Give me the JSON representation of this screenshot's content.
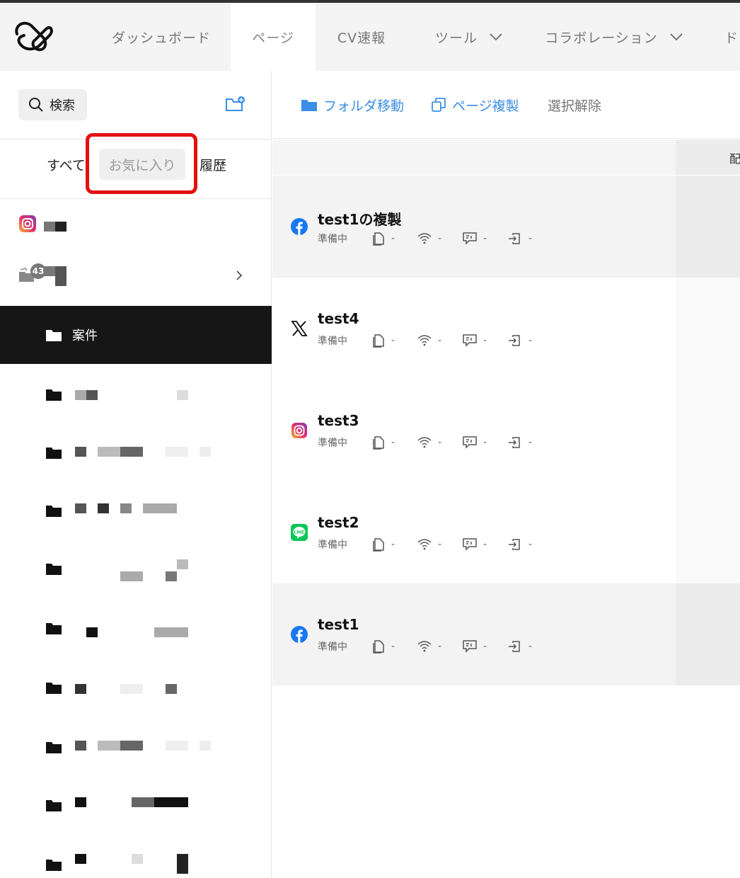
{
  "nav": {
    "tabs": [
      {
        "label": "ダッシュボード",
        "dropdown": false
      },
      {
        "label": "ページ",
        "dropdown": false,
        "active": true
      },
      {
        "label": "CV速報",
        "dropdown": false
      },
      {
        "label": "ツール",
        "dropdown": true
      },
      {
        "label": "コラボレーション",
        "dropdown": true
      },
      {
        "label": "ド",
        "dropdown": false
      }
    ]
  },
  "sidebar": {
    "search_label": "検索",
    "filters": [
      "すべて",
      "お気に入り",
      "履歴"
    ],
    "badge_count": "43",
    "active_folder": "案件"
  },
  "toolbar": {
    "move_folder": "フォルダ移動",
    "duplicate_page": "ページ複製",
    "deselect": "選択解除"
  },
  "table": {
    "partial_header": "配"
  },
  "pages": [
    {
      "title": "test1の複製",
      "status": "準備中",
      "sns": "facebook",
      "stats": [
        "-",
        "-",
        "-",
        "-"
      ]
    },
    {
      "title": "test4",
      "status": "準備中",
      "sns": "x",
      "stats": [
        "-",
        "-",
        "-",
        "-"
      ]
    },
    {
      "title": "test3",
      "status": "準備中",
      "sns": "instagram",
      "stats": [
        "-",
        "-",
        "-",
        "-"
      ]
    },
    {
      "title": "test2",
      "status": "準備中",
      "sns": "line",
      "stats": [
        "-",
        "-",
        "-",
        "-"
      ]
    },
    {
      "title": "test1",
      "status": "準備中",
      "sns": "facebook",
      "stats": [
        "-",
        "-",
        "-",
        "-"
      ]
    }
  ],
  "colors": {
    "accent": "#3a8ee6",
    "highlight": "#e31010",
    "active_folder_bg": "#161616",
    "facebook": "#1877f2",
    "line": "#06c755"
  }
}
